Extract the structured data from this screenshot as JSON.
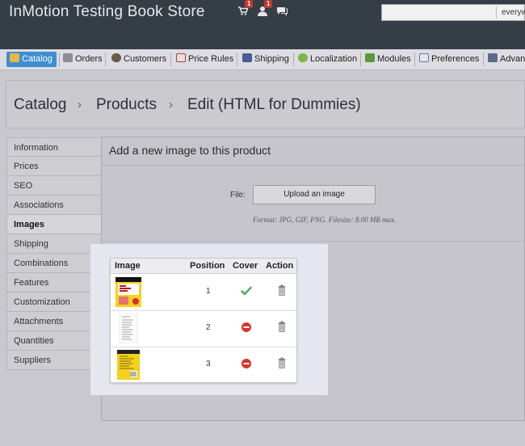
{
  "header": {
    "shop_name": "InMotion Testing Book Store",
    "notifications": [
      {
        "icon": "cart-icon",
        "count": "1"
      },
      {
        "icon": "customers-icon",
        "count": "1"
      },
      {
        "icon": "messages-icon",
        "count": ""
      }
    ],
    "search_scope": "everyw"
  },
  "nav": {
    "items": [
      {
        "label": "Catalog",
        "icon": "catalog-icon"
      },
      {
        "label": "Orders",
        "icon": "orders-icon"
      },
      {
        "label": "Customers",
        "icon": "customers-icon"
      },
      {
        "label": "Price Rules",
        "icon": "price-rules-icon"
      },
      {
        "label": "Shipping",
        "icon": "shipping-icon"
      },
      {
        "label": "Localization",
        "icon": "localization-icon"
      },
      {
        "label": "Modules",
        "icon": "modules-icon"
      },
      {
        "label": "Preferences",
        "icon": "preferences-icon"
      },
      {
        "label": "Advan",
        "icon": "advanced-icon"
      }
    ],
    "active": "Catalog"
  },
  "breadcrumb": [
    "Catalog",
    "Products",
    "Edit (HTML for Dummies)"
  ],
  "breadcrumb_separator": "›",
  "subnav": {
    "items": [
      "Information",
      "Prices",
      "SEO",
      "Associations",
      "Images",
      "Shipping",
      "Combinations",
      "Features",
      "Customization",
      "Attachments",
      "Quantities",
      "Suppliers"
    ],
    "active": "Images"
  },
  "images_panel": {
    "title": "Add a new image to this product",
    "file_label": "File:",
    "upload_button": "Upload an image",
    "format_hint": "Format: JPG, GIF, PNG. Filesize: 8.00 MB max.",
    "table": {
      "headers": [
        "Image",
        "Position",
        "Cover",
        "Action"
      ],
      "rows": [
        {
          "position": "1",
          "cover": true,
          "thumb": "book-cover"
        },
        {
          "position": "2",
          "cover": false,
          "thumb": "book-contents"
        },
        {
          "position": "3",
          "cover": false,
          "thumb": "book-back"
        }
      ]
    }
  },
  "colors": {
    "topbar": "#353d47",
    "active_tab": "#3d8fd1",
    "cover_check": "#4caf50",
    "cover_off": "#d9342b",
    "highlight": "#e6e6f0"
  }
}
